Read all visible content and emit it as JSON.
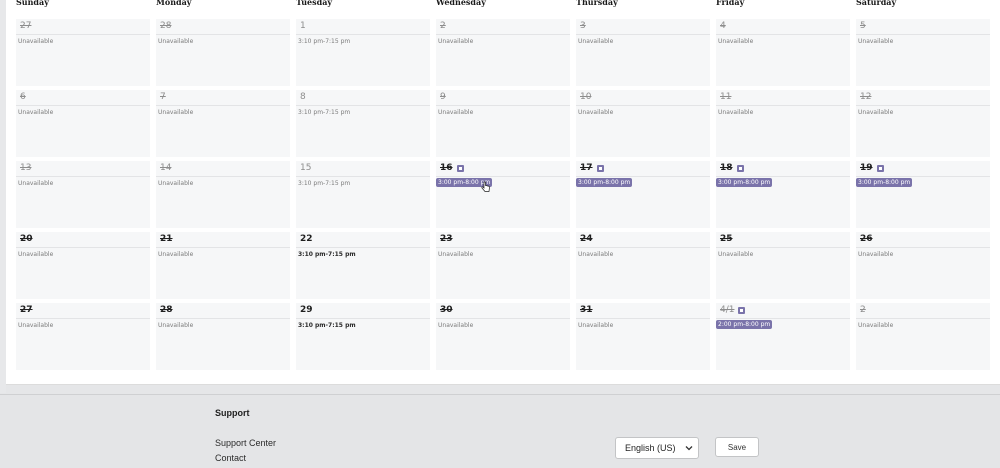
{
  "weekdays": [
    "Sunday",
    "Monday",
    "Tuesday",
    "Wednesday",
    "Thursday",
    "Friday",
    "Saturday"
  ],
  "weeks": [
    [
      {
        "day": "27",
        "struck": true,
        "style": "grey",
        "status": "Unavailable"
      },
      {
        "day": "28",
        "struck": true,
        "style": "grey",
        "status": "Unavailable"
      },
      {
        "day": "1",
        "struck": false,
        "style": "grey",
        "status": "3:10 pm-7:15 pm"
      },
      {
        "day": "2",
        "struck": true,
        "style": "grey",
        "status": "Unavailable"
      },
      {
        "day": "3",
        "struck": true,
        "style": "grey",
        "status": "Unavailable"
      },
      {
        "day": "4",
        "struck": true,
        "style": "grey",
        "status": "Unavailable"
      },
      {
        "day": "5",
        "struck": true,
        "style": "grey",
        "status": "Unavailable"
      }
    ],
    [
      {
        "day": "6",
        "struck": true,
        "style": "grey",
        "status": "Unavailable"
      },
      {
        "day": "7",
        "struck": true,
        "style": "grey",
        "status": "Unavailable"
      },
      {
        "day": "8",
        "struck": false,
        "style": "grey",
        "status": "3:10 pm-7:15 pm"
      },
      {
        "day": "9",
        "struck": true,
        "style": "grey",
        "status": "Unavailable"
      },
      {
        "day": "10",
        "struck": true,
        "style": "grey",
        "status": "Unavailable"
      },
      {
        "day": "11",
        "struck": true,
        "style": "grey",
        "status": "Unavailable"
      },
      {
        "day": "12",
        "struck": true,
        "style": "grey",
        "status": "Unavailable"
      }
    ],
    [
      {
        "day": "13",
        "struck": true,
        "style": "grey",
        "status": "Unavailable"
      },
      {
        "day": "14",
        "struck": true,
        "style": "grey",
        "status": "Unavailable"
      },
      {
        "day": "15",
        "struck": false,
        "style": "grey",
        "status": "3:10 pm-7:15 pm"
      },
      {
        "day": "16",
        "struck": true,
        "style": "dark",
        "pill": "3:00 pm-8:00 pm",
        "icon": true
      },
      {
        "day": "17",
        "struck": true,
        "style": "dark",
        "pill": "3:00 pm-8:00 pm",
        "icon": true
      },
      {
        "day": "18",
        "struck": true,
        "style": "dark",
        "pill": "3:00 pm-8:00 pm",
        "icon": true
      },
      {
        "day": "19",
        "struck": true,
        "style": "dark",
        "pill": "3:00 pm-8:00 pm",
        "icon": true
      }
    ],
    [
      {
        "day": "20",
        "struck": true,
        "style": "dark",
        "status": "Unavailable"
      },
      {
        "day": "21",
        "struck": true,
        "style": "dark",
        "status": "Unavailable"
      },
      {
        "day": "22",
        "struck": false,
        "style": "darkplain",
        "status": "3:10 pm-7:15 pm",
        "statusDark": true
      },
      {
        "day": "23",
        "struck": true,
        "style": "dark",
        "status": "Unavailable"
      },
      {
        "day": "24",
        "struck": true,
        "style": "dark",
        "status": "Unavailable"
      },
      {
        "day": "25",
        "struck": true,
        "style": "dark",
        "status": "Unavailable"
      },
      {
        "day": "26",
        "struck": true,
        "style": "dark",
        "status": "Unavailable"
      }
    ],
    [
      {
        "day": "27",
        "struck": true,
        "style": "dark",
        "status": "Unavailable"
      },
      {
        "day": "28",
        "struck": true,
        "style": "dark",
        "status": "Unavailable"
      },
      {
        "day": "29",
        "struck": false,
        "style": "darkplain",
        "status": "3:10 pm-7:15 pm",
        "statusDark": true
      },
      {
        "day": "30",
        "struck": true,
        "style": "dark",
        "status": "Unavailable"
      },
      {
        "day": "31",
        "struck": true,
        "style": "dark",
        "status": "Unavailable"
      },
      {
        "day": "4/1",
        "struck": true,
        "style": "grey",
        "pill": "2:00 pm-8:00 pm",
        "icon": true
      },
      {
        "day": "2",
        "struck": true,
        "style": "grey",
        "status": "Unavailable"
      }
    ]
  ],
  "footer": {
    "heading": "Support",
    "links": [
      "Support Center",
      "Contact"
    ],
    "language": "English (US)",
    "save_label": "Save"
  },
  "colors": {
    "accent": "#7a73aa",
    "background": "#e5e6e8"
  }
}
